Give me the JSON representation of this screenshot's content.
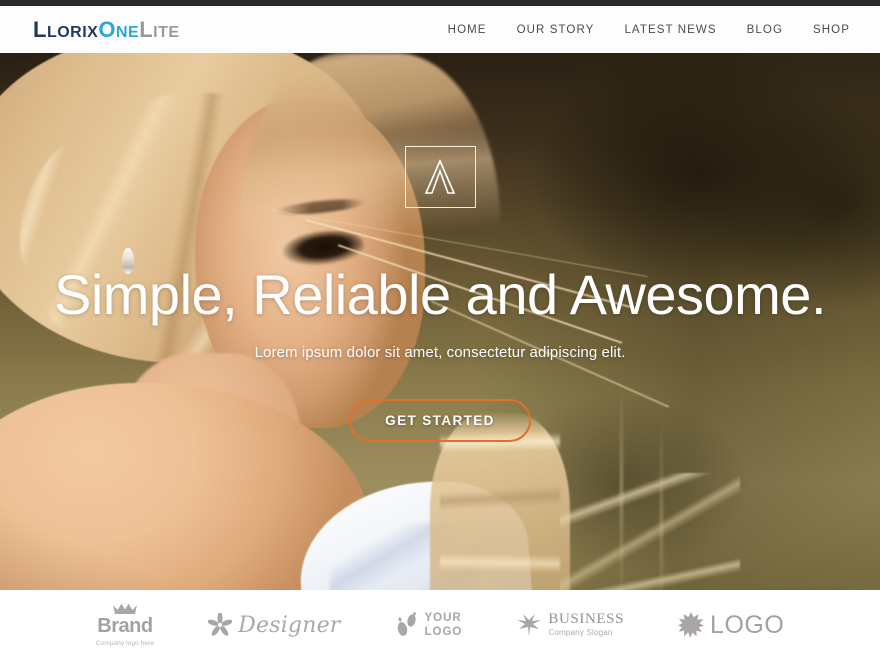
{
  "site": {
    "logo": {
      "part1": "L",
      "part1b": "lorix",
      "part2": "O",
      "part2b": "ne",
      "part3": "L",
      "part3b": "ite",
      "color_dark": "#1d3b57",
      "color_accent": "#2aa9d6",
      "color_muted": "#9a9a9a"
    }
  },
  "nav": {
    "items": [
      {
        "label": "HOME"
      },
      {
        "label": "OUR STORY"
      },
      {
        "label": "LATEST NEWS"
      },
      {
        "label": "BLOG"
      },
      {
        "label": "SHOP"
      }
    ]
  },
  "hero": {
    "badge_icon": "lambda-a-outline-icon",
    "title": "Simple, Reliable and Awesome.",
    "subtitle": "Lorem ipsum dolor sit amet, consectetur adipiscing elit.",
    "cta_label": "GET STARTED",
    "cta_border_color": "#e0702a",
    "text_color": "#ffffff",
    "background_description": "Blonde woman in a field, warm sepia tones"
  },
  "clients": {
    "items": [
      {
        "icon": "crown-icon",
        "name": "Brand",
        "tagline": "Company logo here"
      },
      {
        "icon": "flower-pinwheel-icon",
        "name": "Designer",
        "tagline": ""
      },
      {
        "icon": "footprints-icon",
        "name_line1": "YOUR",
        "name_line2": "LOGO",
        "tagline": ""
      },
      {
        "icon": "leaf-icon",
        "name": "BUSINESS",
        "tagline": "Company Slogan"
      },
      {
        "icon": "starburst-icon",
        "name": "LOGO",
        "tagline": ""
      }
    ]
  }
}
